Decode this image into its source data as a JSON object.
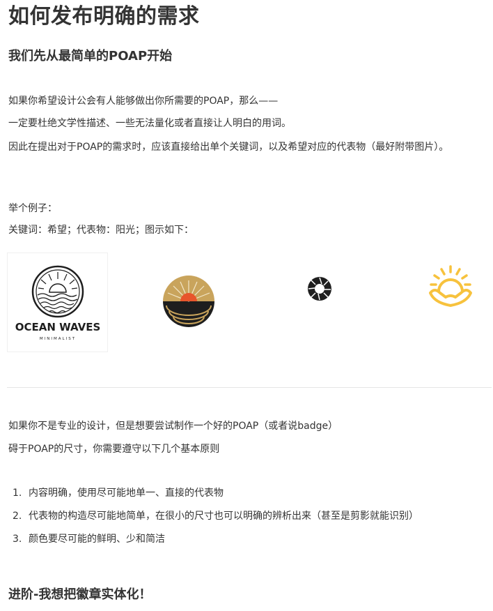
{
  "title": "如何发布明确的需求",
  "section1": {
    "heading": "我们先从最简单的POAP开始",
    "para1": "如果你希望设计公会有人能够做出你所需要的POAP，那么——",
    "para2": "一定要杜绝文学性描述、一些无法量化或者直接让人明白的用词。",
    "para3": "因此在提出对于POAP的需求时，应该直接给出单个关键词，以及希望对应的代表物（最好附带图片）。",
    "example_label": "举个例子：",
    "example_keywords": "关键词：希望；代表物：阳光；图示如下："
  },
  "examples": {
    "logo1_text": "OCEAN WAVES",
    "logo1_subtext": "MINIMALIST",
    "icons": [
      "ocean-waves-logo",
      "sunset-badge-icon",
      "sun-swirl-icon",
      "sun-in-hand-icon"
    ],
    "colors": {
      "gold": "#c9a45c",
      "dark": "#1e1e1e",
      "orange": "#e8552c",
      "yellow": "#f7c23d"
    }
  },
  "section2": {
    "para1": "如果你不是专业的设计，但是想要尝试制作一个好的POAP（或者说badge）",
    "para2": "碍于POAP的尺寸，你需要遵守以下几个基本原则",
    "list": [
      {
        "num": "1.",
        "text": "内容明确，使用尽可能地单一、直接的代表物"
      },
      {
        "num": "2.",
        "text": "代表物的构造尽可能地简单，在很小的尺寸也可以明确的辨析出来（甚至是剪影就能识别）"
      },
      {
        "num": "3.",
        "text": "颜色要尽可能的鲜明、少和简洁"
      }
    ]
  },
  "section3": {
    "heading": "进阶-我想把徽章实体化！"
  }
}
